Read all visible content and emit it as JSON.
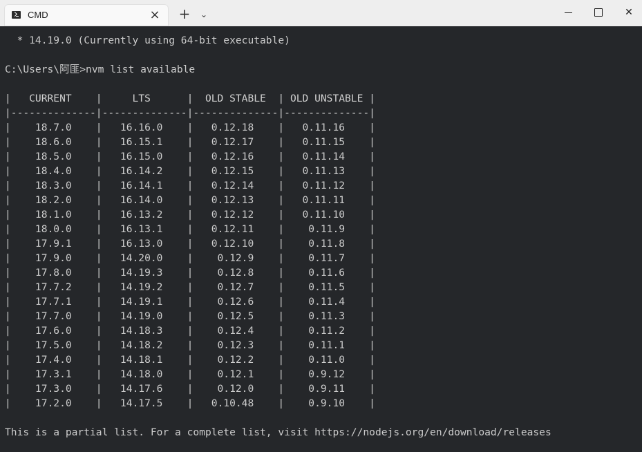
{
  "window": {
    "tab_title": "CMD",
    "tab_close_icon": "close-icon",
    "new_tab_icon": "plus-icon",
    "dropdown_icon": "chevron-down-icon",
    "minimize_icon": "minimize-icon",
    "maximize_icon": "maximize-icon",
    "close_icon": "close-icon"
  },
  "console": {
    "line1": "  * 14.19.0 (Currently using 64-bit executable)",
    "line2": "C:\\Users\\阿匪>nvm list available",
    "header": "|   CURRENT    |     LTS      |  OLD STABLE  | OLD UNSTABLE |",
    "divider": "|--------------|--------------|--------------|--------------|",
    "rows": [
      "|    18.7.0    |   16.16.0    |   0.12.18    |   0.11.16    |",
      "|    18.6.0    |   16.15.1    |   0.12.17    |   0.11.15    |",
      "|    18.5.0    |   16.15.0    |   0.12.16    |   0.11.14    |",
      "|    18.4.0    |   16.14.2    |   0.12.15    |   0.11.13    |",
      "|    18.3.0    |   16.14.1    |   0.12.14    |   0.11.12    |",
      "|    18.2.0    |   16.14.0    |   0.12.13    |   0.11.11    |",
      "|    18.1.0    |   16.13.2    |   0.12.12    |   0.11.10    |",
      "|    18.0.0    |   16.13.1    |   0.12.11    |    0.11.9    |",
      "|    17.9.1    |   16.13.0    |   0.12.10    |    0.11.8    |",
      "|    17.9.0    |   14.20.0    |    0.12.9    |    0.11.7    |",
      "|    17.8.0    |   14.19.3    |    0.12.8    |    0.11.6    |",
      "|    17.7.2    |   14.19.2    |    0.12.7    |    0.11.5    |",
      "|    17.7.1    |   14.19.1    |    0.12.6    |    0.11.4    |",
      "|    17.7.0    |   14.19.0    |    0.12.5    |    0.11.3    |",
      "|    17.6.0    |   14.18.3    |    0.12.4    |    0.11.2    |",
      "|    17.5.0    |   14.18.2    |    0.12.3    |    0.11.1    |",
      "|    17.4.0    |   14.18.1    |    0.12.2    |    0.11.0    |",
      "|    17.3.1    |   14.18.0    |    0.12.1    |    0.9.12    |",
      "|    17.3.0    |   14.17.6    |    0.12.0    |    0.9.11    |",
      "|    17.2.0    |   14.17.5    |   0.10.48    |    0.9.10    |"
    ],
    "footer": "This is a partial list. For a complete list, visit https://nodejs.org/en/download/releases"
  }
}
